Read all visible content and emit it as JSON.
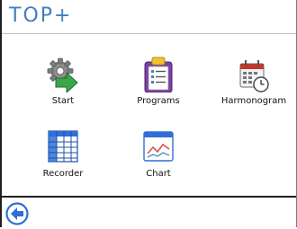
{
  "header": {
    "logo_text": "TOP+"
  },
  "apps": [
    {
      "label": "Start",
      "icon": "gear-arrow-icon"
    },
    {
      "label": "Programs",
      "icon": "clipboard-list-icon"
    },
    {
      "label": "Harmonogram",
      "icon": "calendar-clock-icon"
    },
    {
      "label": "Recorder",
      "icon": "grid-table-icon"
    },
    {
      "label": "Chart",
      "icon": "line-chart-icon"
    }
  ],
  "footer": {
    "back_icon": "back-arrow-icon"
  },
  "colors": {
    "accent": "#3f7fbf",
    "green": "#3aa64a",
    "blue": "#2f6fd6"
  }
}
